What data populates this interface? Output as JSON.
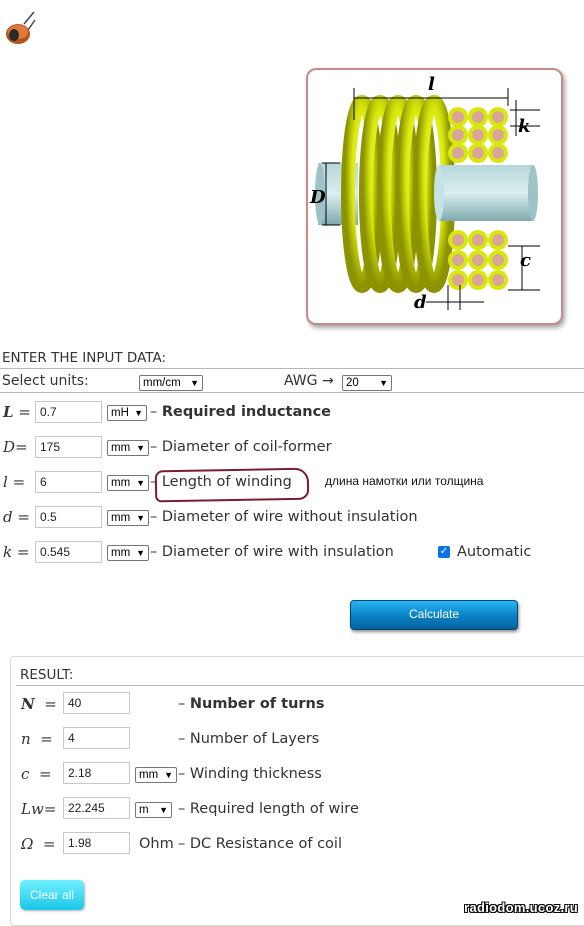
{
  "header": {
    "icon": "inductor-icon"
  },
  "diagram": {
    "labels": {
      "l": "l",
      "k": "k",
      "D": "D",
      "c": "c",
      "d": "d"
    }
  },
  "input": {
    "title": "ENTER THE INPUT DATA:",
    "units_label": "Select units:",
    "units_value": "mm/cm",
    "awg_label": "AWG →",
    "awg_value": "20",
    "rows": [
      {
        "symbol": "L",
        "eq": "=",
        "value": "0.7",
        "unit": "mH",
        "desc_prefix": "–",
        "desc": "Required inductance"
      },
      {
        "symbol": "D",
        "eq": "=",
        "value": "175",
        "unit": "mm",
        "desc_prefix": "–",
        "desc": "Diameter of coil-former"
      },
      {
        "symbol": "l",
        "eq": "=",
        "value": "6",
        "unit": "mm",
        "desc_prefix": "–",
        "desc": "Length of winding"
      },
      {
        "symbol": "d",
        "eq": "=",
        "value": "0.5",
        "unit": "mm",
        "desc_prefix": "–",
        "desc": "Diameter of wire without insulation"
      },
      {
        "symbol": "k",
        "eq": "=",
        "value": "0.545",
        "unit": "mm",
        "desc_prefix": "–",
        "desc": "Diameter of wire with insulation"
      }
    ],
    "automatic_label": "Automatic",
    "automatic_checked": true,
    "annotation": "длина намотки или толщина"
  },
  "calculate_label": "Calculate",
  "result": {
    "title": "RESULT:",
    "rows": [
      {
        "symbol": "N",
        "eq": "=",
        "value": "40",
        "unit": "",
        "desc_prefix": "–",
        "desc": "Number of turns"
      },
      {
        "symbol": "n",
        "eq": "=",
        "value": "4",
        "unit": "",
        "desc_prefix": "–",
        "desc": "Number of Layers"
      },
      {
        "symbol": "c",
        "eq": "=",
        "value": "2.18",
        "unit": "mm",
        "desc_prefix": "–",
        "desc": "Winding thickness"
      },
      {
        "symbol": "Lw",
        "eq": "=",
        "value": "22.245",
        "unit": "m",
        "desc_prefix": "–",
        "desc": "Required length of wire"
      },
      {
        "symbol": "Ω",
        "eq": "=",
        "value": "1.98",
        "unit": "Ohm",
        "desc_prefix": "–",
        "desc": "DC Resistance of coil"
      }
    ]
  },
  "clear_label": "Clear all",
  "watermark": "radiodom.ucoz.ru",
  "colors": {
    "accent": "#0a84c8",
    "clear": "#1ac7e8",
    "coil": "#d9e80c",
    "annotation": "#7a1d2e"
  }
}
